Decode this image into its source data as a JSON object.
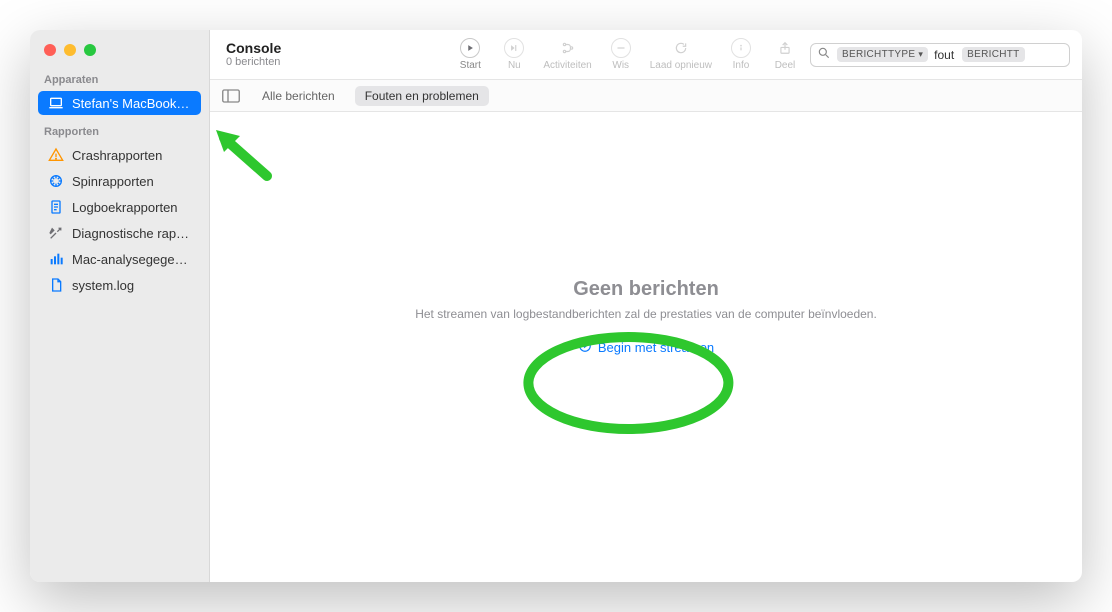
{
  "window": {
    "title": "Console",
    "subtitle": "0 berichten"
  },
  "toolbar": {
    "start": "Start",
    "now": "Nu",
    "activities": "Activiteiten",
    "clear": "Wis",
    "reload": "Laad opnieuw",
    "info": "Info",
    "share": "Deel"
  },
  "search": {
    "token1": "BERICHTTYPE",
    "text": "fout",
    "token2": "BERICHTT"
  },
  "filters": {
    "all": "Alle berichten",
    "errors": "Fouten en problemen"
  },
  "sidebar": {
    "devices_header": "Apparaten",
    "device": "Stefan's MacBook…",
    "reports_header": "Rapporten",
    "reports": {
      "crash": "Crashrapporten",
      "spin": "Spinrapporten",
      "log": "Logboekrapporten",
      "diag": "Diagnostische rap…",
      "mac": "Mac-analysegege…",
      "system": "system.log"
    }
  },
  "empty": {
    "title": "Geen berichten",
    "subtitle": "Het streamen van logbestandberichten zal de prestaties van de computer beïnvloeden.",
    "action": "Begin met streamen"
  }
}
